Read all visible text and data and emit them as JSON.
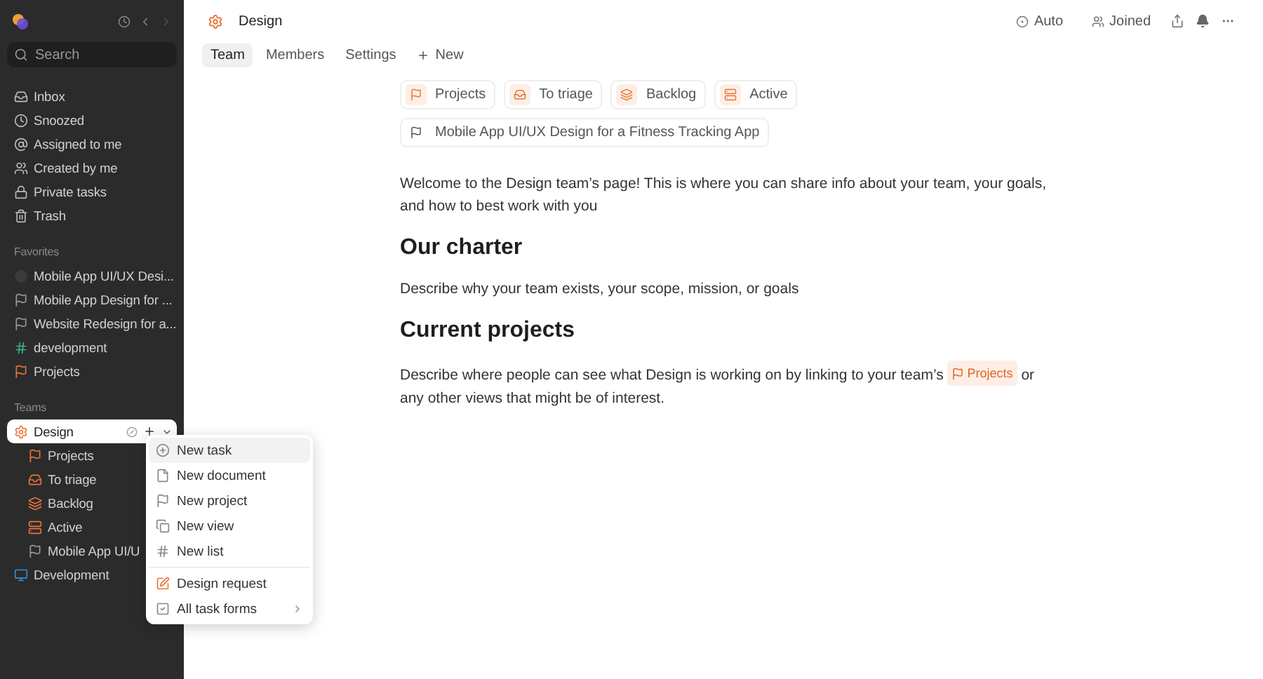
{
  "sidebar": {
    "search": {
      "placeholder": "Search"
    },
    "nav": [
      {
        "label": "Inbox"
      },
      {
        "label": "Snoozed"
      },
      {
        "label": "Assigned to me"
      },
      {
        "label": "Created by me"
      },
      {
        "label": "Private tasks"
      },
      {
        "label": "Trash"
      }
    ],
    "favorites": {
      "title": "Favorites",
      "items": [
        {
          "label": "Mobile App UI/UX Desi...",
          "kind": "circle",
          "color": "#3a3a3a"
        },
        {
          "label": "Mobile App Design for ...",
          "kind": "flag",
          "color": "#9a9a9a"
        },
        {
          "label": "Website Redesign for a...",
          "kind": "flag",
          "color": "#9a9a9a"
        },
        {
          "label": "development",
          "kind": "hash",
          "color": "#3fb37f"
        },
        {
          "label": "Projects",
          "kind": "flag",
          "color": "#e8743b"
        }
      ]
    },
    "teams": {
      "title": "Teams",
      "items": [
        {
          "label": "Design",
          "selected": true,
          "kind": "gear",
          "color": "#e8743b",
          "children": [
            {
              "label": "Projects",
              "kind": "flag",
              "color": "#e8743b"
            },
            {
              "label": "To triage",
              "kind": "triage",
              "color": "#e8743b"
            },
            {
              "label": "Backlog",
              "kind": "layers",
              "color": "#e8743b"
            },
            {
              "label": "Active",
              "kind": "stack",
              "color": "#e8743b"
            },
            {
              "label": "Mobile App UI/U",
              "kind": "flag",
              "color": "#9a9a9a"
            }
          ]
        },
        {
          "label": "Development",
          "selected": false,
          "kind": "monitor",
          "color": "#2f8fd8"
        }
      ]
    }
  },
  "header": {
    "title": "Design",
    "actions": [
      {
        "label": "Auto"
      },
      {
        "label": "Joined"
      }
    ]
  },
  "tabs": [
    {
      "label": "Team",
      "selected": true
    },
    {
      "label": "Members",
      "selected": false
    },
    {
      "label": "Settings",
      "selected": false
    }
  ],
  "new_tab": {
    "label": "New"
  },
  "chips": [
    [
      {
        "label": "Projects",
        "kind": "flag"
      },
      {
        "label": "To triage",
        "kind": "triage"
      },
      {
        "label": "Backlog",
        "kind": "layers"
      },
      {
        "label": "Active",
        "kind": "stack"
      }
    ],
    [
      {
        "label": "Mobile App UI/UX Design for a Fitness Tracking App",
        "kind": "plainflag"
      }
    ]
  ],
  "content": [
    {
      "kind": "paragraph",
      "text": "Welcome to the Design team’s page! This is where you can share info about your team, your goals, and how to best work with you"
    },
    {
      "kind": "heading",
      "text": "Our charter"
    },
    {
      "kind": "paragraph",
      "text": "Describe why your team exists, your scope, mission, or goals"
    },
    {
      "kind": "heading",
      "text": "Current projects"
    },
    {
      "kind": "linked",
      "before": "Describe where people can see what Design is working on by linking to your team’s",
      "link": "Projects",
      "after": "or any other views that might be of interest."
    }
  ],
  "menu": {
    "groups": [
      [
        {
          "label": "New task",
          "kind": "task",
          "highlighted": true
        },
        {
          "label": "New document",
          "kind": "doc",
          "highlighted": false
        },
        {
          "label": "New project",
          "kind": "flag",
          "highlighted": false
        },
        {
          "label": "New view",
          "kind": "view",
          "highlighted": false
        },
        {
          "label": "New list",
          "kind": "hash",
          "highlighted": false
        }
      ],
      [
        {
          "label": "Design request",
          "kind": "form",
          "highlighted": false
        },
        {
          "label": "All task forms",
          "kind": "check",
          "highlighted": false,
          "submenu": true
        }
      ]
    ]
  }
}
